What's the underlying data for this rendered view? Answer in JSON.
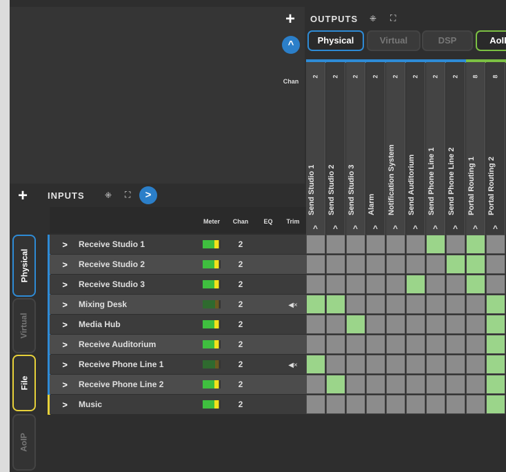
{
  "outputs": {
    "title": "OUTPUTS",
    "tabs": [
      {
        "label": "Physical",
        "state": "active-blue"
      },
      {
        "label": "Virtual",
        "state": "disabled"
      },
      {
        "label": "DSP",
        "state": "disabled"
      },
      {
        "label": "AoIP",
        "state": "active-green"
      }
    ],
    "chan_label": "Chan",
    "columns": [
      {
        "name": "Send Studio 1",
        "chan": "2"
      },
      {
        "name": "Send Studio 2",
        "chan": "2"
      },
      {
        "name": "Send Studio 3",
        "chan": "2"
      },
      {
        "name": "Alarm",
        "chan": "2"
      },
      {
        "name": "Notification System",
        "chan": "2"
      },
      {
        "name": "Send Auditorium",
        "chan": "2"
      },
      {
        "name": "Send Phone Line 1",
        "chan": "2"
      },
      {
        "name": "Send Phone Line 2",
        "chan": "2"
      },
      {
        "name": "Portal Routing 1",
        "chan": "8"
      },
      {
        "name": "Portal Routing 2",
        "chan": "8"
      }
    ]
  },
  "inputs": {
    "title": "INPUTS",
    "headers": {
      "meter": "Meter",
      "chan": "Chan",
      "eq": "EQ",
      "trim": "Trim"
    },
    "tabs": [
      {
        "label": "Physical",
        "state": "active-blue"
      },
      {
        "label": "Virtual",
        "state": "disabled"
      },
      {
        "label": "File",
        "state": "active-yellow"
      },
      {
        "label": "AoIP",
        "state": "disabled"
      }
    ],
    "rows": [
      {
        "name": "Receive Studio 1",
        "chan": "2",
        "meter": "active",
        "muted": false,
        "group": "blue"
      },
      {
        "name": "Receive Studio 2",
        "chan": "2",
        "meter": "active",
        "muted": false,
        "group": "blue"
      },
      {
        "name": "Receive Studio 3",
        "chan": "2",
        "meter": "active",
        "muted": false,
        "group": "blue"
      },
      {
        "name": "Mixing Desk",
        "chan": "2",
        "meter": "dim",
        "muted": true,
        "group": "blue"
      },
      {
        "name": "Media Hub",
        "chan": "2",
        "meter": "active",
        "muted": false,
        "group": "blue"
      },
      {
        "name": "Receive Auditorium",
        "chan": "2",
        "meter": "active",
        "muted": false,
        "group": "blue"
      },
      {
        "name": "Receive Phone Line 1",
        "chan": "2",
        "meter": "dim",
        "muted": true,
        "group": "blue"
      },
      {
        "name": "Receive Phone Line 2",
        "chan": "2",
        "meter": "active",
        "muted": false,
        "group": "blue"
      },
      {
        "name": "Music",
        "chan": "2",
        "meter": "active",
        "muted": false,
        "group": "yellow"
      }
    ]
  },
  "matrix": [
    [
      0,
      0,
      0,
      0,
      0,
      0,
      1,
      0,
      1,
      0
    ],
    [
      0,
      0,
      0,
      0,
      0,
      0,
      0,
      1,
      1,
      0
    ],
    [
      0,
      0,
      0,
      0,
      0,
      1,
      0,
      0,
      1,
      0
    ],
    [
      1,
      1,
      0,
      0,
      0,
      0,
      0,
      0,
      0,
      1
    ],
    [
      0,
      0,
      1,
      0,
      0,
      0,
      0,
      0,
      0,
      1
    ],
    [
      0,
      0,
      0,
      0,
      0,
      0,
      0,
      0,
      0,
      1
    ],
    [
      1,
      0,
      0,
      0,
      0,
      0,
      0,
      0,
      0,
      1
    ],
    [
      0,
      1,
      0,
      0,
      0,
      0,
      0,
      0,
      0,
      1
    ],
    [
      0,
      0,
      0,
      0,
      0,
      0,
      0,
      0,
      0,
      1
    ]
  ],
  "icons": {
    "plus": "+",
    "collapse": "⁜",
    "expand": "⛶",
    "chevron_up": "^",
    "chevron_right": ">",
    "mute": "🔇"
  },
  "colors": {
    "accent_blue": "#2e8bd6",
    "accent_green": "#7cc143",
    "accent_yellow": "#e8d23a",
    "cell_on": "#9bd58a",
    "cell_off": "#8c8c8c"
  }
}
